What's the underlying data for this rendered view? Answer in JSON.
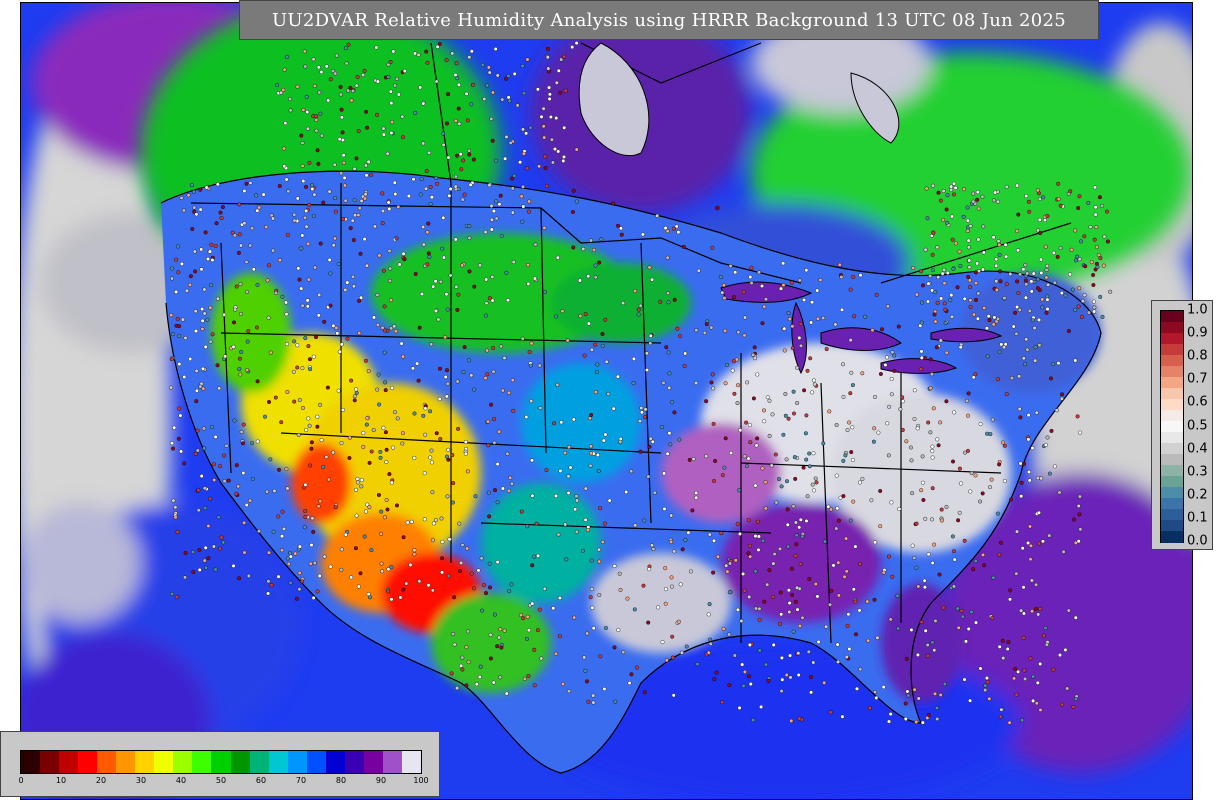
{
  "title": "UU2DVAR Relative Humidity Analysis using HRRR Background 13 UTC 08 Jun 2025",
  "rh_colorbar": {
    "ticks": [
      "0",
      "10",
      "20",
      "30",
      "40",
      "50",
      "60",
      "70",
      "80",
      "90",
      "100"
    ],
    "colors": [
      "#2a0000",
      "#7a0000",
      "#c00000",
      "#ff0000",
      "#ff5a00",
      "#ff9600",
      "#ffd200",
      "#f0ff00",
      "#9cff00",
      "#3cff00",
      "#00d000",
      "#009600",
      "#00b478",
      "#00c8d2",
      "#0096ff",
      "#0050ff",
      "#0000d2",
      "#3c00b4",
      "#7800a0",
      "#a050c8",
      "#e6e6f0"
    ]
  },
  "increment_colorbar": {
    "ticks": [
      "1.0",
      "0.9",
      "0.8",
      "0.7",
      "0.6",
      "0.5",
      "0.4",
      "0.3",
      "0.2",
      "0.1",
      "0.0"
    ],
    "colors": [
      "#67001f",
      "#8b0a22",
      "#b2182b",
      "#c63c3a",
      "#d6604d",
      "#e58368",
      "#f4a582",
      "#f8c5ad",
      "#fddbc7",
      "#f6eae6",
      "#f7f7f7",
      "#e8e8e8",
      "#d1d1d1",
      "#bababa",
      "#8fb2a6",
      "#6aa295",
      "#4c8eaa",
      "#3a74a8",
      "#2c5f9a",
      "#1f4a85",
      "#053061"
    ]
  }
}
